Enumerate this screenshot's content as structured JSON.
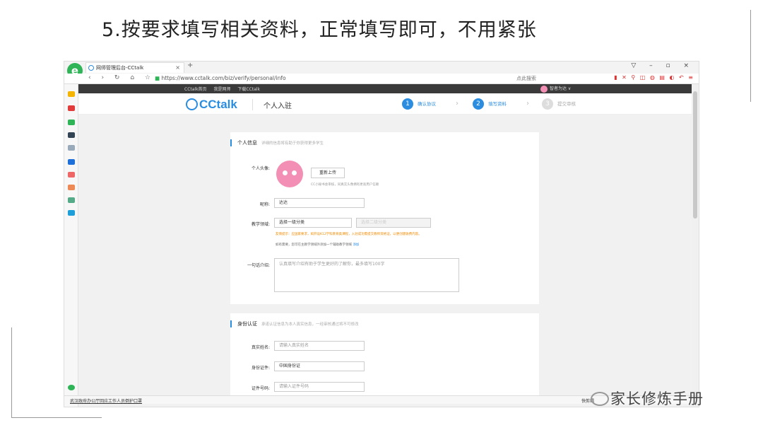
{
  "caption": "5.按要求填写相关资料，正常填写即可，不用紧张",
  "browser": {
    "tab_title": "网师管理后台-CCtalk",
    "url": "https://www.cctalk.com/biz/verify/personal/info",
    "search_placeholder": "点此搜索"
  },
  "topbar": {
    "links": "CCtalk首页 我是网师 下载CCtalk",
    "user": "智者为达 ∨"
  },
  "header": {
    "brand": "CCtalk",
    "title": "个人入驻",
    "steps": [
      {
        "num": "1",
        "label": "确认协议"
      },
      {
        "num": "2",
        "label": "填写资料"
      },
      {
        "num": "3",
        "label": "提交审核"
      }
    ]
  },
  "personal": {
    "title": "个人信息",
    "hint": "详细的信息将有助于你获得更多学生",
    "avatar_label": "个人头像:",
    "reupload": "重新上传",
    "avatar_hint": "CC小秘书会审核，同真实头像拥有更高用户信赖",
    "nickname_label": "昵称:",
    "nickname_value": "达达",
    "field_label": "教学领域:",
    "field_primary": "选择一级分类",
    "field_secondary": "选择二级分类",
    "field_warn": "友情提示：应国家要求，如开设K12学科教育类课程，入驻成功需提交教师资格证，以便创建收费内容。",
    "field_more": "如有需要，您可在主教学领域外添加一个辅助教学领域",
    "field_add": "添加",
    "intro_label": "一句话介绍:",
    "intro_placeholder": "认真填写介绍有助于学生更好的了解你，最多填写100字"
  },
  "identity": {
    "title": "身份认证",
    "hint": "承诺认证信息为本人真实信息，一经审核通过将不可修改",
    "name_label": "真实姓名:",
    "name_placeholder": "请输入真实姓名",
    "id_type_label": "身份证件:",
    "id_type_value": "中国身份证",
    "id_no_label": "证件号码:",
    "id_no_placeholder": "请输入证件号码"
  },
  "status": {
    "left": "武汉政府办公厅回应工作人员倒护口罩",
    "right": "快剪辑"
  },
  "watermark": "家长修炼手册"
}
